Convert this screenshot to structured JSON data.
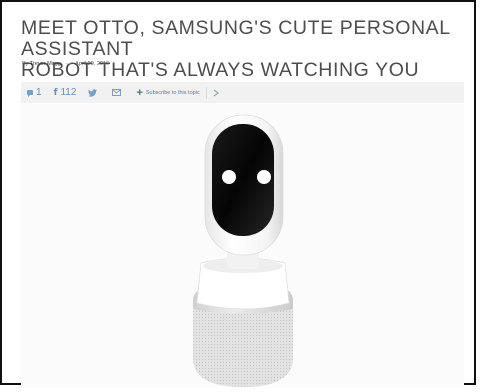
{
  "article": {
    "title_line1": "MEET OTTO, SAMSUNG'S CUTE PERSONAL ASSISTANT",
    "title_line2": "ROBOT THAT'S ALWAYS WATCHING YOU",
    "byline_prefix": "By",
    "author": "Trevor Mogg",
    "date": "April 29, 2016"
  },
  "share_bar": {
    "comment_count": "1",
    "facebook_count": "112",
    "subscribe_label": "Subscribe to this topic"
  },
  "icons": [
    "comment-icon",
    "facebook-icon",
    "twitter-icon",
    "mail-icon",
    "plus-icon",
    "chevron-right-icon"
  ],
  "colors": {
    "headline": "#4d4d4d",
    "toolbar_bg": "#f1f1f1",
    "link_blue": "#4a7fb5"
  }
}
